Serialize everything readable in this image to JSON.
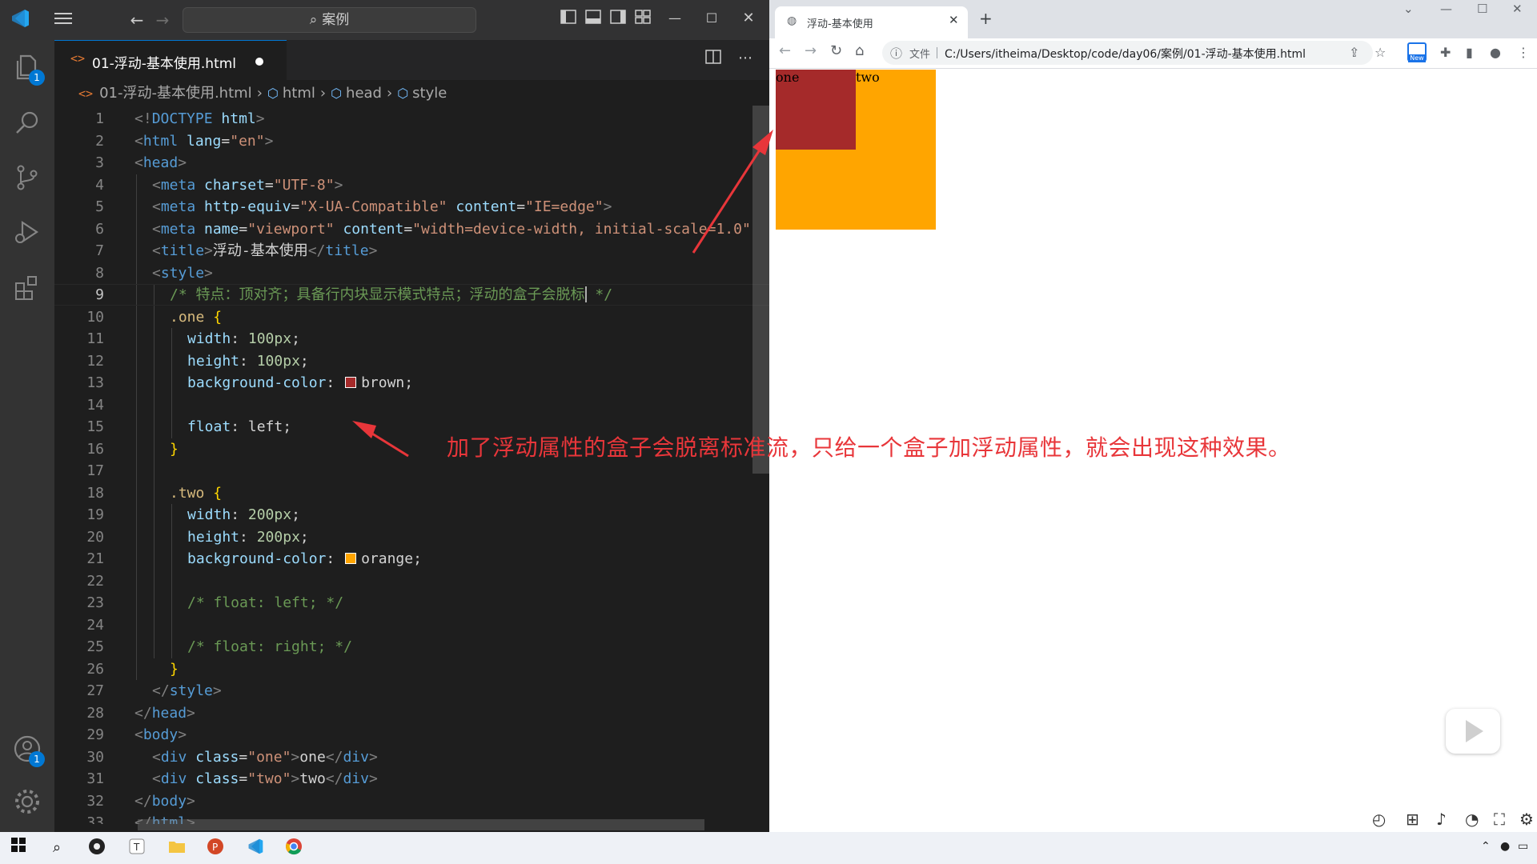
{
  "vscode": {
    "search_text": "案例",
    "tab": {
      "label": "01-浮动-基本使用.html"
    },
    "breadcrumb": [
      "01-浮动-基本使用.html",
      "html",
      "head",
      "style"
    ],
    "activity_badges": {
      "explorer": "1",
      "accounts": "1"
    },
    "code_lines": [
      {
        "n": "1",
        "indent": 0,
        "tokens": [
          {
            "c": "t-punc",
            "t": "<!"
          },
          {
            "c": "t-tag",
            "t": "DOCTYPE"
          },
          {
            "c": "t-plain",
            "t": " "
          },
          {
            "c": "t-attr",
            "t": "html"
          },
          {
            "c": "t-punc",
            "t": ">"
          }
        ]
      },
      {
        "n": "2",
        "indent": 0,
        "tokens": [
          {
            "c": "t-punc",
            "t": "<"
          },
          {
            "c": "t-tag",
            "t": "html"
          },
          {
            "c": "t-plain",
            "t": " "
          },
          {
            "c": "t-attr",
            "t": "lang"
          },
          {
            "c": "t-plain",
            "t": "="
          },
          {
            "c": "t-str",
            "t": "\"en\""
          },
          {
            "c": "t-punc",
            "t": ">"
          }
        ]
      },
      {
        "n": "3",
        "indent": 0,
        "tokens": [
          {
            "c": "t-punc",
            "t": "<"
          },
          {
            "c": "t-tag",
            "t": "head"
          },
          {
            "c": "t-punc",
            "t": ">"
          }
        ]
      },
      {
        "n": "4",
        "indent": 1,
        "tokens": [
          {
            "c": "t-punc",
            "t": "<"
          },
          {
            "c": "t-tag",
            "t": "meta"
          },
          {
            "c": "t-plain",
            "t": " "
          },
          {
            "c": "t-attr",
            "t": "charset"
          },
          {
            "c": "t-plain",
            "t": "="
          },
          {
            "c": "t-str",
            "t": "\"UTF-8\""
          },
          {
            "c": "t-punc",
            "t": ">"
          }
        ]
      },
      {
        "n": "5",
        "indent": 1,
        "tokens": [
          {
            "c": "t-punc",
            "t": "<"
          },
          {
            "c": "t-tag",
            "t": "meta"
          },
          {
            "c": "t-plain",
            "t": " "
          },
          {
            "c": "t-attr",
            "t": "http-equiv"
          },
          {
            "c": "t-plain",
            "t": "="
          },
          {
            "c": "t-str",
            "t": "\"X-UA-Compatible\""
          },
          {
            "c": "t-plain",
            "t": " "
          },
          {
            "c": "t-attr",
            "t": "content"
          },
          {
            "c": "t-plain",
            "t": "="
          },
          {
            "c": "t-str",
            "t": "\"IE=edge\""
          },
          {
            "c": "t-punc",
            "t": ">"
          }
        ]
      },
      {
        "n": "6",
        "indent": 1,
        "tokens": [
          {
            "c": "t-punc",
            "t": "<"
          },
          {
            "c": "t-tag",
            "t": "meta"
          },
          {
            "c": "t-plain",
            "t": " "
          },
          {
            "c": "t-attr",
            "t": "name"
          },
          {
            "c": "t-plain",
            "t": "="
          },
          {
            "c": "t-str",
            "t": "\"viewport\""
          },
          {
            "c": "t-plain",
            "t": " "
          },
          {
            "c": "t-attr",
            "t": "content"
          },
          {
            "c": "t-plain",
            "t": "="
          },
          {
            "c": "t-str",
            "t": "\"width=device-width, initial-scale=1.0\""
          }
        ]
      },
      {
        "n": "7",
        "indent": 1,
        "tokens": [
          {
            "c": "t-punc",
            "t": "<"
          },
          {
            "c": "t-tag",
            "t": "title"
          },
          {
            "c": "t-punc",
            "t": ">"
          },
          {
            "c": "t-plain",
            "t": "浮动-基本使用"
          },
          {
            "c": "t-punc",
            "t": "</"
          },
          {
            "c": "t-tag",
            "t": "title"
          },
          {
            "c": "t-punc",
            "t": ">"
          }
        ]
      },
      {
        "n": "8",
        "indent": 1,
        "tokens": [
          {
            "c": "t-punc",
            "t": "<"
          },
          {
            "c": "t-tag",
            "t": "style"
          },
          {
            "c": "t-punc",
            "t": ">"
          }
        ]
      },
      {
        "n": "9",
        "indent": 2,
        "active": true,
        "caret_after": 0,
        "tokens": [
          {
            "c": "t-com",
            "t": "/* 特点：顶对齐；具备行内块显示模式特点；浮动的盒子会脱标"
          },
          {
            "c": "caret",
            "t": ""
          },
          {
            "c": "t-com",
            "t": " */"
          }
        ]
      },
      {
        "n": "10",
        "indent": 2,
        "tokens": [
          {
            "c": "t-sel",
            "t": ".one"
          },
          {
            "c": "t-plain",
            "t": " "
          },
          {
            "c": "t-brace",
            "t": "{"
          }
        ]
      },
      {
        "n": "11",
        "indent": 3,
        "tokens": [
          {
            "c": "t-prop",
            "t": "width"
          },
          {
            "c": "t-plain",
            "t": ": "
          },
          {
            "c": "t-num",
            "t": "100px"
          },
          {
            "c": "t-plain",
            "t": ";"
          }
        ]
      },
      {
        "n": "12",
        "indent": 3,
        "tokens": [
          {
            "c": "t-prop",
            "t": "height"
          },
          {
            "c": "t-plain",
            "t": ": "
          },
          {
            "c": "t-num",
            "t": "100px"
          },
          {
            "c": "t-plain",
            "t": ";"
          }
        ]
      },
      {
        "n": "13",
        "indent": 3,
        "tokens": [
          {
            "c": "t-prop",
            "t": "background-color"
          },
          {
            "c": "t-plain",
            "t": ": "
          },
          {
            "c": "swatch",
            "t": "#a52a2a"
          },
          {
            "c": "t-plain",
            "t": "brown;"
          }
        ]
      },
      {
        "n": "14",
        "indent": 3,
        "tokens": []
      },
      {
        "n": "15",
        "indent": 3,
        "tokens": [
          {
            "c": "t-prop",
            "t": "float"
          },
          {
            "c": "t-plain",
            "t": ": left;"
          }
        ]
      },
      {
        "n": "16",
        "indent": 2,
        "tokens": [
          {
            "c": "t-brace",
            "t": "}"
          }
        ]
      },
      {
        "n": "17",
        "indent": 2,
        "tokens": []
      },
      {
        "n": "18",
        "indent": 2,
        "tokens": [
          {
            "c": "t-sel",
            "t": ".two"
          },
          {
            "c": "t-plain",
            "t": " "
          },
          {
            "c": "t-brace",
            "t": "{"
          }
        ]
      },
      {
        "n": "19",
        "indent": 3,
        "tokens": [
          {
            "c": "t-prop",
            "t": "width"
          },
          {
            "c": "t-plain",
            "t": ": "
          },
          {
            "c": "t-num",
            "t": "200px"
          },
          {
            "c": "t-plain",
            "t": ";"
          }
        ]
      },
      {
        "n": "20",
        "indent": 3,
        "tokens": [
          {
            "c": "t-prop",
            "t": "height"
          },
          {
            "c": "t-plain",
            "t": ": "
          },
          {
            "c": "t-num",
            "t": "200px"
          },
          {
            "c": "t-plain",
            "t": ";"
          }
        ]
      },
      {
        "n": "21",
        "indent": 3,
        "tokens": [
          {
            "c": "t-prop",
            "t": "background-color"
          },
          {
            "c": "t-plain",
            "t": ": "
          },
          {
            "c": "swatch",
            "t": "#ffa500"
          },
          {
            "c": "t-plain",
            "t": "orange;"
          }
        ]
      },
      {
        "n": "22",
        "indent": 3,
        "tokens": []
      },
      {
        "n": "23",
        "indent": 3,
        "tokens": [
          {
            "c": "t-com",
            "t": "/* float: left; */"
          }
        ]
      },
      {
        "n": "24",
        "indent": 3,
        "tokens": []
      },
      {
        "n": "25",
        "indent": 3,
        "tokens": [
          {
            "c": "t-com",
            "t": "/* float: right; */"
          }
        ]
      },
      {
        "n": "26",
        "indent": 2,
        "tokens": [
          {
            "c": "t-brace",
            "t": "}"
          }
        ]
      },
      {
        "n": "27",
        "indent": 1,
        "tokens": [
          {
            "c": "t-punc",
            "t": "</"
          },
          {
            "c": "t-tag",
            "t": "style"
          },
          {
            "c": "t-punc",
            "t": ">"
          }
        ]
      },
      {
        "n": "28",
        "indent": 0,
        "tokens": [
          {
            "c": "t-punc",
            "t": "</"
          },
          {
            "c": "t-tag",
            "t": "head"
          },
          {
            "c": "t-punc",
            "t": ">"
          }
        ]
      },
      {
        "n": "29",
        "indent": 0,
        "tokens": [
          {
            "c": "t-punc",
            "t": "<"
          },
          {
            "c": "t-tag",
            "t": "body"
          },
          {
            "c": "t-punc",
            "t": ">"
          }
        ]
      },
      {
        "n": "30",
        "indent": 1,
        "tokens": [
          {
            "c": "t-punc",
            "t": "<"
          },
          {
            "c": "t-tag",
            "t": "div"
          },
          {
            "c": "t-plain",
            "t": " "
          },
          {
            "c": "t-attr",
            "t": "class"
          },
          {
            "c": "t-plain",
            "t": "="
          },
          {
            "c": "t-str",
            "t": "\"one\""
          },
          {
            "c": "t-punc",
            "t": ">"
          },
          {
            "c": "t-plain",
            "t": "one"
          },
          {
            "c": "t-punc",
            "t": "</"
          },
          {
            "c": "t-tag",
            "t": "div"
          },
          {
            "c": "t-punc",
            "t": ">"
          }
        ]
      },
      {
        "n": "31",
        "indent": 1,
        "tokens": [
          {
            "c": "t-punc",
            "t": "<"
          },
          {
            "c": "t-tag",
            "t": "div"
          },
          {
            "c": "t-plain",
            "t": " "
          },
          {
            "c": "t-attr",
            "t": "class"
          },
          {
            "c": "t-plain",
            "t": "="
          },
          {
            "c": "t-str",
            "t": "\"two\""
          },
          {
            "c": "t-punc",
            "t": ">"
          },
          {
            "c": "t-plain",
            "t": "two"
          },
          {
            "c": "t-punc",
            "t": "</"
          },
          {
            "c": "t-tag",
            "t": "div"
          },
          {
            "c": "t-punc",
            "t": ">"
          }
        ]
      },
      {
        "n": "32",
        "indent": 0,
        "tokens": [
          {
            "c": "t-punc",
            "t": "</"
          },
          {
            "c": "t-tag",
            "t": "body"
          },
          {
            "c": "t-punc",
            "t": ">"
          }
        ]
      },
      {
        "n": "33",
        "indent": 0,
        "tokens": [
          {
            "c": "t-punc",
            "t": "</"
          },
          {
            "c": "t-tag",
            "t": "html"
          },
          {
            "c": "t-punc",
            "t": ">"
          }
        ]
      }
    ]
  },
  "browser": {
    "tab_title": "浮动-基本使用",
    "scheme_label": "文件",
    "url": "C:/Users/itheima/Desktop/code/day06/案例/01-浮动-基本使用.html",
    "new_badge": "New",
    "page": {
      "one_text": "one",
      "two_text": "two",
      "one_color": "#a52a2a",
      "two_color": "#ffa500"
    }
  },
  "annotation": {
    "text": "加了浮动属性的盒子会脱离标准流，只给一个盒子加浮动属性，就会出现这种效果。",
    "color": "#e8363a"
  },
  "icons": [
    "vscode-logo-icon",
    "menu-icon",
    "back-icon",
    "forward-icon",
    "search-icon",
    "layout-icon",
    "minimize-icon",
    "maximize-icon",
    "close-icon",
    "explorer-icon",
    "search-view-icon",
    "source-control-icon",
    "run-debug-icon",
    "extensions-icon",
    "accounts-icon",
    "settings-gear-icon",
    "split-editor-icon",
    "more-actions-icon",
    "globe-icon",
    "reload-icon",
    "home-icon",
    "info-icon",
    "share-icon",
    "star-icon",
    "puzzle-icon",
    "sidepanel-icon",
    "profile-icon",
    "kebab-icon",
    "play-icon",
    "windows-start-icon",
    "taskbar-search-icon",
    "chrome-icon",
    "vscode-taskbar-icon",
    "powerpoint-icon",
    "explorer-folder-icon",
    "typora-icon",
    "obs-icon"
  ]
}
